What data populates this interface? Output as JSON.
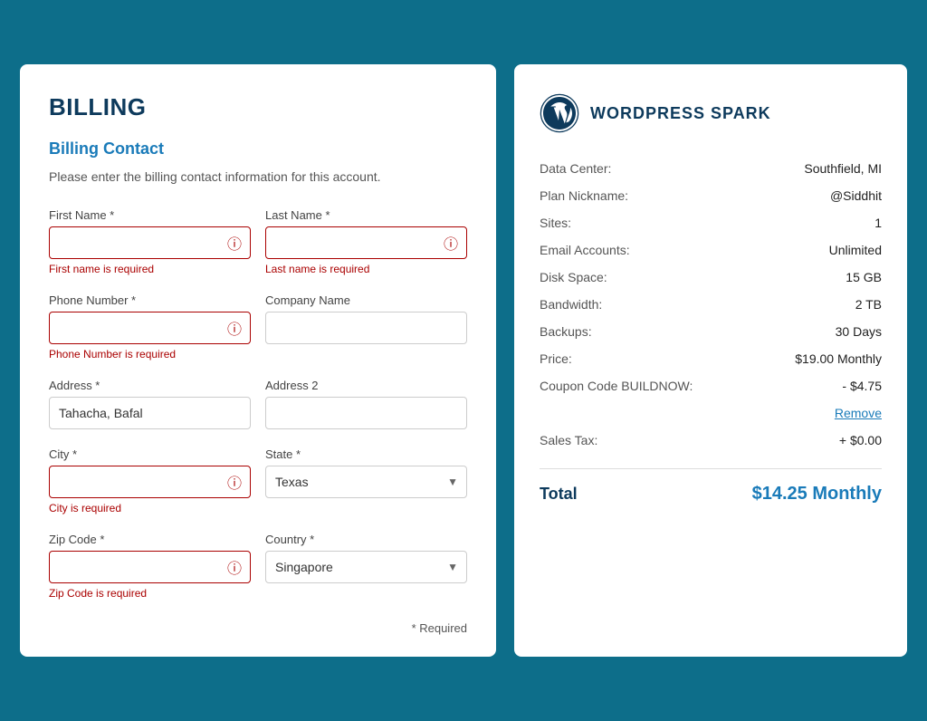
{
  "billing": {
    "page_title": "BILLING",
    "section_title": "Billing Contact",
    "section_desc": "Please enter the billing contact information for this account.",
    "fields": {
      "first_name_label": "First Name *",
      "last_name_label": "Last Name *",
      "phone_label": "Phone Number *",
      "company_label": "Company Name",
      "address_label": "Address *",
      "address2_label": "Address 2",
      "city_label": "City *",
      "state_label": "State *",
      "zip_label": "Zip Code *",
      "country_label": "Country *"
    },
    "values": {
      "address": "Tahacha, Bafal",
      "state": "Texas",
      "country": "Singapore"
    },
    "errors": {
      "first_name": "First name is required",
      "last_name": "Last name is required",
      "phone": "Phone Number is required",
      "city": "City is required",
      "zip": "Zip Code is required"
    },
    "required_note": "* Required"
  },
  "summary": {
    "logo_alt": "WordPress Logo",
    "title": "WORDPRESS SPARK",
    "rows": [
      {
        "label": "Data Center:",
        "value": "Southfield, MI"
      },
      {
        "label": "Plan Nickname:",
        "value": "@Siddhit"
      },
      {
        "label": "Sites:",
        "value": "1"
      },
      {
        "label": "Email Accounts:",
        "value": "Unlimited"
      },
      {
        "label": "Disk Space:",
        "value": "15 GB"
      },
      {
        "label": "Bandwidth:",
        "value": "2 TB"
      },
      {
        "label": "Backups:",
        "value": "30 Days"
      },
      {
        "label": "Price:",
        "value": "$19.00 Monthly"
      },
      {
        "label": "Coupon Code BUILDNOW:",
        "value": "- $4.75"
      },
      {
        "label": "Sales Tax:",
        "value": "+ $0.00"
      }
    ],
    "remove_link": "Remove",
    "total_label": "Total",
    "total_value": "$14.25 Monthly"
  },
  "icons": {
    "error": "ⓘ",
    "chevron_down": "▾"
  }
}
